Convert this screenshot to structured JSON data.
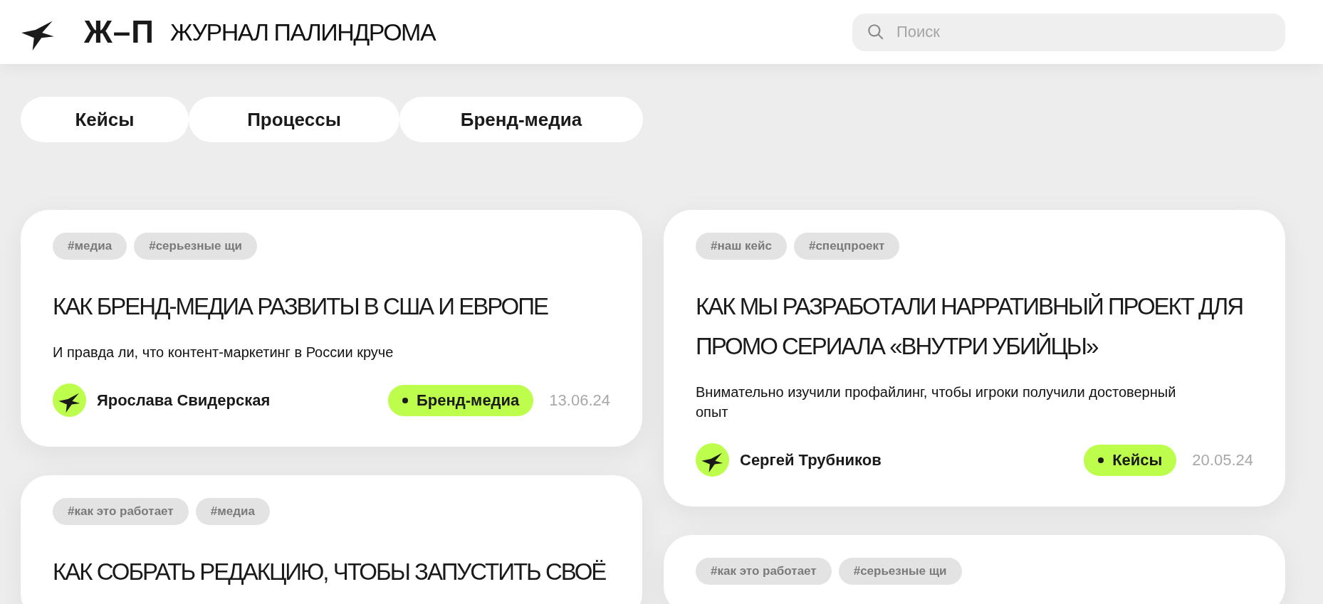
{
  "header": {
    "logo_mark": "Ж–П",
    "title": "ЖУРНАЛ ПАЛИНДРОМА"
  },
  "search": {
    "placeholder": "Поиск"
  },
  "categories": [
    {
      "label": "Кейсы",
      "selected": false
    },
    {
      "label": "Процессы",
      "selected": false
    },
    {
      "label": "Бренд-медиа",
      "selected": false
    }
  ],
  "columns": [
    {
      "articles": [
        {
          "tags": [
            "#медиа",
            "#серьезные щи"
          ],
          "title": "КАК БРЕНД-МЕДИА РАЗВИТЫ В США И ЕВРОПЕ",
          "subtitle": "И правда ли, что контент-маркетинг в России круче",
          "author": "Ярослава Свидерская",
          "category": "Бренд-медиа",
          "date": "13.06.24"
        },
        {
          "tags": [
            "#как это работает",
            "#медиа"
          ],
          "title": "КАК СОБРАТЬ РЕДАКЦИЮ, ЧТОБЫ ЗАПУСТИТЬ СВОЁ"
        }
      ]
    },
    {
      "articles": [
        {
          "tags": [
            "#наш кейс",
            "#спецпроект"
          ],
          "title": "КАК МЫ РАЗРАБОТАЛИ НАРРАТИВНЫЙ ПРОЕКТ ДЛЯ ПРОМО СЕРИАЛА «ВНУТРИ УБИЙЦЫ»",
          "subtitle": "Внимательно изучили профайлинг, чтобы игроки получили достоверный опыт",
          "author": "Сергей Трубников",
          "category": "Кейсы",
          "date": "20.05.24"
        },
        {
          "tags": [
            "#как это работает",
            "#серьезные щи"
          ]
        }
      ]
    }
  ]
}
